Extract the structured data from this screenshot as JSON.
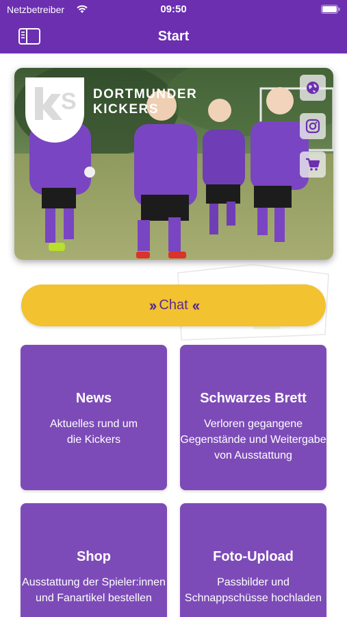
{
  "status_bar": {
    "carrier": "Netzbetreiber",
    "time": "09:50"
  },
  "nav": {
    "title": "Start"
  },
  "hero": {
    "logo_letters": "KS",
    "brand_line1": "DORTMUNDER",
    "brand_line2": "KICKERS",
    "side_icons": [
      "globe-icon",
      "instagram-icon",
      "cart-icon"
    ]
  },
  "chat_button": {
    "label": "Chat"
  },
  "tiles": [
    {
      "title": "News",
      "desc_line1": "Aktuelles rund um",
      "desc_line2": "die Kickers",
      "desc_line3": ""
    },
    {
      "title": "Schwarzes Brett",
      "desc_line1": "Verloren gegangene",
      "desc_line2": "Gegenstände und Weitergabe",
      "desc_line3": "von Ausstattung"
    },
    {
      "title": "Shop",
      "desc_line1": "Ausstattung der Spieler:innen",
      "desc_line2": "und Fanartikel bestellen",
      "desc_line3": ""
    },
    {
      "title": "Foto-Upload",
      "desc_line1": "Passbilder und",
      "desc_line2": "Schnappschüsse hochladen",
      "desc_line3": ""
    }
  ],
  "colors": {
    "brand_purple": "#6b2fb0",
    "tile_purple": "#7d4bb8",
    "chat_yellow": "#f2c230",
    "chat_text": "#5a2b91"
  }
}
